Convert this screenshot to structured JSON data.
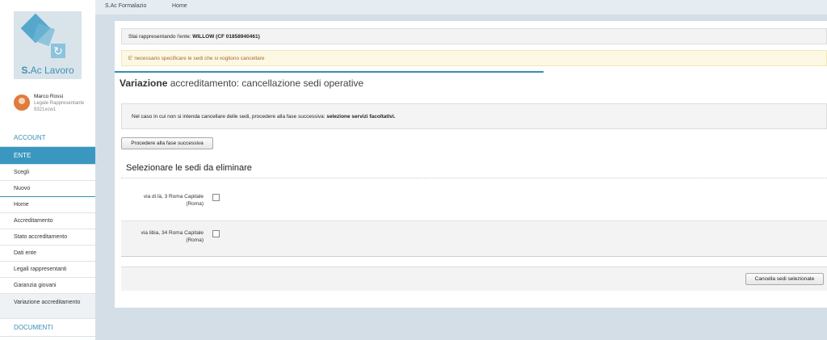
{
  "app": {
    "logo_text_bold": "S.",
    "logo_text": "Ac Lavoro"
  },
  "user": {
    "name": "Marco Rossi",
    "role": "Legale Rappresentante",
    "code": "9321xcw1"
  },
  "topbar": {
    "link1": "S.Ac Formalazio",
    "link2": "Home"
  },
  "sidebar": {
    "account": "ACCOUNT",
    "ente": "ENTE",
    "ente_items": [
      "Scegli",
      "Nuovo"
    ],
    "items": [
      "Home",
      "Accreditamento",
      "Stato accreditamento",
      "Dati ente",
      "Legali rappresentanti",
      "Garanzia giovani",
      "Variazione accreditamento"
    ],
    "documenti": "DOCUMENTI"
  },
  "alerts": {
    "info_prefix": "Stai rappresentando l'ente: ",
    "info_entity": "WILLOW (CF 01858940461)",
    "warning": "E' necessario specificare le sedi che si vogliono cancellare"
  },
  "page": {
    "title_bold": "Variazione",
    "title_rest": " accreditamento: cancellazione sedi operative"
  },
  "note": {
    "text": "Nel caso in cui non si intenda cancellare delle sedi, procedere alla fase successiva: ",
    "bold": "selezione servizi facoltativi."
  },
  "buttons": {
    "next": "Procedere alla fase successiva",
    "delete": "Cancella sedi selezionate"
  },
  "section": {
    "title": "Selezionare le sedi da eliminare"
  },
  "sedi": [
    {
      "line1": "via di là, 3 Roma Capitale",
      "line2": "(Roma)",
      "checked": false
    },
    {
      "line1": "via libia, 34 Roma Capitale",
      "line2": "(Roma)",
      "checked": false
    }
  ]
}
